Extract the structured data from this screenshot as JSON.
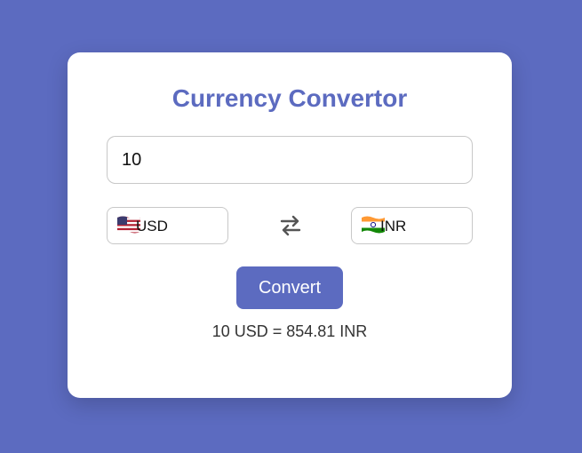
{
  "app": {
    "title": "Currency Convertor"
  },
  "amount": {
    "value": "10"
  },
  "from_currency": {
    "code": "USD",
    "flag_icon": "us-flag-icon"
  },
  "to_currency": {
    "code": "INR",
    "flag_icon": "india-flag-icon"
  },
  "swap_icon": "swap-arrows-icon",
  "convert_button": {
    "label": "Convert"
  },
  "result": {
    "text": "10 USD = 854.81 INR"
  },
  "colors": {
    "accent": "#5c6bc0",
    "card": "#ffffff"
  }
}
